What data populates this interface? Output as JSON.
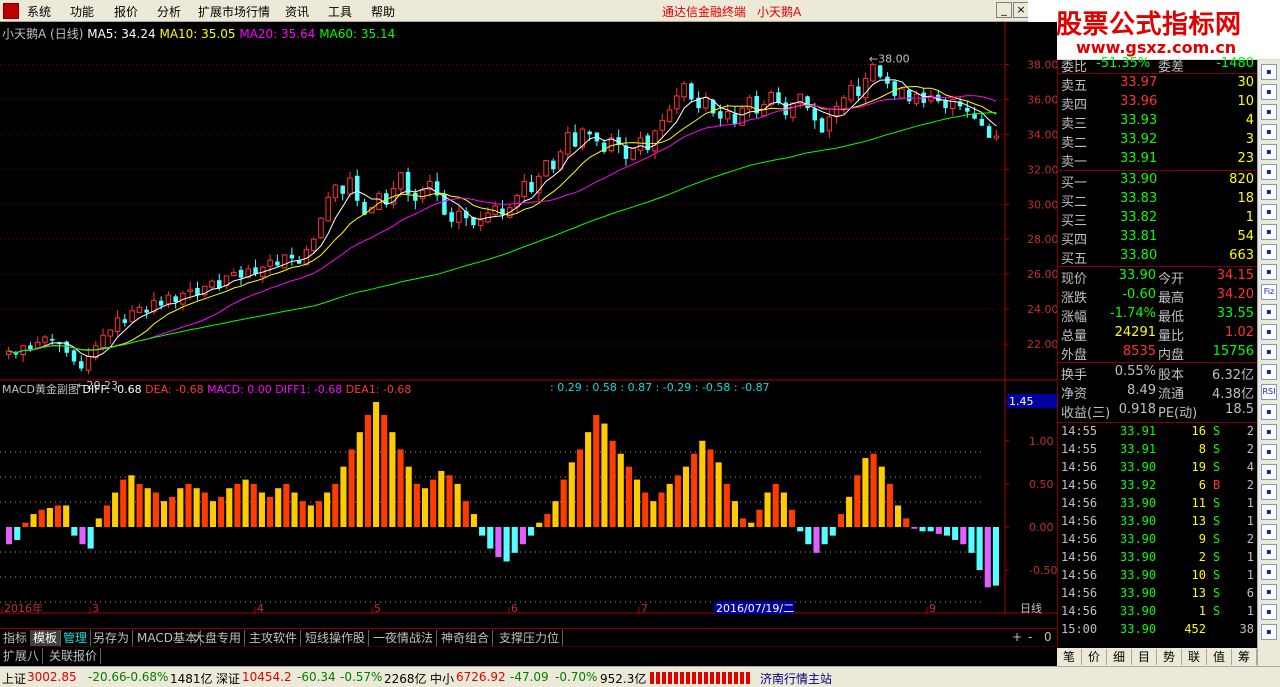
{
  "menu": {
    "items": [
      "系统",
      "功能",
      "报价",
      "分析",
      "扩展市场行情",
      "资讯",
      "工具",
      "帮助"
    ],
    "promo": [
      "通达信金融终端",
      "小天鹅A"
    ]
  },
  "watermark": {
    "title": "股票公式指标网",
    "url": "www.gsxz.com.cn"
  },
  "chart": {
    "legend_name": "小天鹅A (日线)",
    "ma5": "MA5: 34.24",
    "ma10": "MA10: 35.05",
    "ma20": "MA20: 35.64",
    "ma60": "MA60: 35.14",
    "high_label": "38.00",
    "low_label": "20.23",
    "price_ticks": [
      "38.00",
      "36.00",
      "34.00",
      "32.00",
      "30.00",
      "28.00",
      "26.00",
      "24.00",
      "22.00"
    ],
    "macd_ticks": [
      "1.45",
      "1.00",
      "0.50",
      "0.00",
      "-0.50"
    ],
    "macd_legend": {
      "name": "MACD黄金副图",
      "diff": "DIFF: -0.68",
      "dea": "DEA: -0.68",
      "macd": "MACD: 0.00",
      "diff1": "DIFF1: -0.68",
      "dea1": "DEA1: -0.68"
    },
    "macd_values": ": 0.29 : 0.58 : 0.87 : -0.29 : -0.58 : -0.87",
    "date_axis": [
      "2016年",
      "3",
      "4",
      "5",
      "6",
      "7",
      "9"
    ],
    "cursor_date": "2016/07/19/二",
    "period": "日线",
    "colors": {
      "up": "#ff3232",
      "down": "#54ffff",
      "ma5": "#ffffff",
      "ma10": "#ffff00",
      "ma20": "#ff00ff",
      "ma60": "#00ff00",
      "grid": "#800000"
    }
  },
  "chart_data": {
    "type": "candlestick",
    "title": "小天鹅A (日线)",
    "ylim": [
      20,
      39
    ],
    "high": 38.0,
    "low": 20.23,
    "closes": [
      21.6,
      21.4,
      21.9,
      21.7,
      22.1,
      22.4,
      22.2,
      22.0,
      21.5,
      21.0,
      20.6,
      21.3,
      21.9,
      22.5,
      22.8,
      23.5,
      23.2,
      23.9,
      24.1,
      23.8,
      24.5,
      24.2,
      24.8,
      24.4,
      24.9,
      25.1,
      24.8,
      25.3,
      25.6,
      25.2,
      25.9,
      26.1,
      25.8,
      26.3,
      26.0,
      26.4,
      26.8,
      26.5,
      27.1,
      26.9,
      26.6,
      27.4,
      28.0,
      29.2,
      30.4,
      31.1,
      30.6,
      31.5,
      30.2,
      29.4,
      29.8,
      30.6,
      30.0,
      30.9,
      31.8,
      30.6,
      30.2,
      30.8,
      31.3,
      30.5,
      29.4,
      29.0,
      29.6,
      29.2,
      28.8,
      29.1,
      29.5,
      29.9,
      29.4,
      29.8,
      30.5,
      31.3,
      30.7,
      31.6,
      32.5,
      32.0,
      33.0,
      34.1,
      33.3,
      34.3,
      34.0,
      33.6,
      33.0,
      33.8,
      33.4,
      32.6,
      33.2,
      33.8,
      33.1,
      34.2,
      34.8,
      35.4,
      36.2,
      36.9,
      36.0,
      35.5,
      36.1,
      35.2,
      34.9,
      35.3,
      34.6,
      35.5,
      36.1,
      35.2,
      35.7,
      36.4,
      35.8,
      35.1,
      35.8,
      36.3,
      35.5,
      34.8,
      34.1,
      35.0,
      35.6,
      36.1,
      36.8,
      36.2,
      37.2,
      38.0,
      37.3,
      36.9,
      36.2,
      36.6,
      35.9,
      36.3,
      35.8,
      36.2,
      35.9,
      35.5,
      36.0,
      35.6,
      35.3,
      34.9,
      34.5,
      33.8,
      33.9
    ],
    "macd_hist": [
      -0.2,
      -0.15,
      0.05,
      0.15,
      0.2,
      0.22,
      0.25,
      0.25,
      -0.1,
      -0.2,
      -0.25,
      0.1,
      0.25,
      0.4,
      0.55,
      0.6,
      0.5,
      0.45,
      0.4,
      0.3,
      0.35,
      0.45,
      0.5,
      0.45,
      0.4,
      0.3,
      0.35,
      0.45,
      0.5,
      0.55,
      0.5,
      0.4,
      0.35,
      0.45,
      0.5,
      0.4,
      0.3,
      0.25,
      0.3,
      0.4,
      0.5,
      0.7,
      0.9,
      1.1,
      1.3,
      1.45,
      1.3,
      1.1,
      0.9,
      0.7,
      0.5,
      0.45,
      0.55,
      0.65,
      0.6,
      0.5,
      0.3,
      0.15,
      -0.1,
      -0.25,
      -0.35,
      -0.4,
      -0.3,
      -0.2,
      -0.1,
      0.05,
      0.15,
      0.3,
      0.55,
      0.75,
      0.9,
      1.1,
      1.3,
      1.2,
      1.0,
      0.85,
      0.7,
      0.55,
      0.4,
      0.3,
      0.4,
      0.5,
      0.6,
      0.7,
      0.85,
      1.0,
      0.9,
      0.75,
      0.5,
      0.3,
      0.1,
      0.05,
      0.2,
      0.4,
      0.5,
      0.4,
      0.2,
      -0.05,
      -0.2,
      -0.3,
      -0.2,
      -0.1,
      0.15,
      0.35,
      0.6,
      0.8,
      0.85,
      0.7,
      0.5,
      0.25,
      0.1,
      -0.02,
      -0.05,
      -0.05,
      -0.08,
      -0.1,
      -0.15,
      -0.2,
      -0.3,
      -0.5,
      -0.7,
      -0.68
    ]
  },
  "quote": {
    "weibi_label": "委比",
    "weibi": "-51.35%",
    "weicha_label": "委差",
    "weicha": "-1480",
    "sell": [
      {
        "label": "卖五",
        "price": "33.97",
        "vol": "30"
      },
      {
        "label": "卖四",
        "price": "33.96",
        "vol": "10"
      },
      {
        "label": "卖三",
        "price": "33.93",
        "vol": "4"
      },
      {
        "label": "卖二",
        "price": "33.92",
        "vol": "3"
      },
      {
        "label": "卖一",
        "price": "33.91",
        "vol": "23"
      }
    ],
    "buy": [
      {
        "label": "买一",
        "price": "33.90",
        "vol": "820"
      },
      {
        "label": "买二",
        "price": "33.83",
        "vol": "18"
      },
      {
        "label": "买三",
        "price": "33.82",
        "vol": "1"
      },
      {
        "label": "买四",
        "price": "33.81",
        "vol": "54"
      },
      {
        "label": "买五",
        "price": "33.80",
        "vol": "663"
      }
    ],
    "stats": [
      {
        "l1": "现价",
        "v1": "33.90",
        "c1": "#00ff00",
        "l2": "今开",
        "v2": "34.15",
        "c2": "#ff3232"
      },
      {
        "l1": "涨跌",
        "v1": "-0.60",
        "c1": "#00ff00",
        "l2": "最高",
        "v2": "34.20",
        "c2": "#ff3232"
      },
      {
        "l1": "涨幅",
        "v1": "-1.74%",
        "c1": "#00ff00",
        "l2": "最低",
        "v2": "33.55",
        "c2": "#00ff00"
      },
      {
        "l1": "总量",
        "v1": "24291",
        "c1": "#ffff00",
        "l2": "量比",
        "v2": "1.02",
        "c2": "#ff3232"
      },
      {
        "l1": "外盘",
        "v1": "8535",
        "c1": "#ff3232",
        "l2": "内盘",
        "v2": "15756",
        "c2": "#00ff00"
      }
    ],
    "stats2": [
      {
        "l1": "换手",
        "v1": "0.55%",
        "l2": "股本",
        "v2": "6.32亿"
      },
      {
        "l1": "净资",
        "v1": "8.49",
        "l2": "流通",
        "v2": "4.38亿"
      },
      {
        "l1": "收益(三)",
        "v1": "0.918",
        "l2": "PE(动)",
        "v2": "18.5"
      }
    ],
    "ticks": [
      {
        "time": "14:55",
        "price": "33.91",
        "vol": "16",
        "side": "S",
        "n": "2"
      },
      {
        "time": "14:55",
        "price": "33.91",
        "vol": "8",
        "side": "S",
        "n": "2"
      },
      {
        "time": "14:56",
        "price": "33.90",
        "vol": "19",
        "side": "S",
        "n": "4"
      },
      {
        "time": "14:56",
        "price": "33.92",
        "vol": "6",
        "side": "B",
        "n": "2"
      },
      {
        "time": "14:56",
        "price": "33.90",
        "vol": "11",
        "side": "S",
        "n": "1"
      },
      {
        "time": "14:56",
        "price": "33.90",
        "vol": "13",
        "side": "S",
        "n": "1"
      },
      {
        "time": "14:56",
        "price": "33.90",
        "vol": "9",
        "side": "S",
        "n": "2"
      },
      {
        "time": "14:56",
        "price": "33.90",
        "vol": "2",
        "side": "S",
        "n": "1"
      },
      {
        "time": "14:56",
        "price": "33.90",
        "vol": "10",
        "side": "S",
        "n": "1"
      },
      {
        "time": "14:56",
        "price": "33.90",
        "vol": "13",
        "side": "S",
        "n": "6"
      },
      {
        "time": "14:56",
        "price": "33.90",
        "vol": "1",
        "side": "S",
        "n": "1"
      },
      {
        "time": "15:00",
        "price": "33.90",
        "vol": "452",
        "side": "",
        "n": "38"
      }
    ],
    "tabs": [
      "笔",
      "价",
      "细",
      "目",
      "势",
      "联",
      "值",
      "筹"
    ]
  },
  "side_toolbar": [
    "Fiz",
    "RSI"
  ],
  "bottom_tabs": [
    "指标",
    "模板",
    "管理",
    "另存为",
    "MACD基本",
    "大盘专用",
    "主攻软件",
    "短线操作股",
    "一夜情战法",
    "神奇组合",
    "支撑压力位"
  ],
  "ext_tabs": [
    "扩展八",
    "关联报价"
  ],
  "status": {
    "sh_label": "上证",
    "sh_value": "3002.85",
    "sh_change": "-20.66",
    "sh_pct": "-0.68%",
    "sh_amount": "1481亿",
    "sz_label": "深证",
    "sz_value": "10454.2",
    "sz_change": "-60.34",
    "sz_pct": "-0.57%",
    "sz_amount": "2268亿",
    "zx_label": "中小",
    "zx_value": "6726.92",
    "zx_change": "-47.09",
    "zx_pct": "-0.70%",
    "zx_amount": "952.3亿",
    "server": "济南行情主站"
  }
}
